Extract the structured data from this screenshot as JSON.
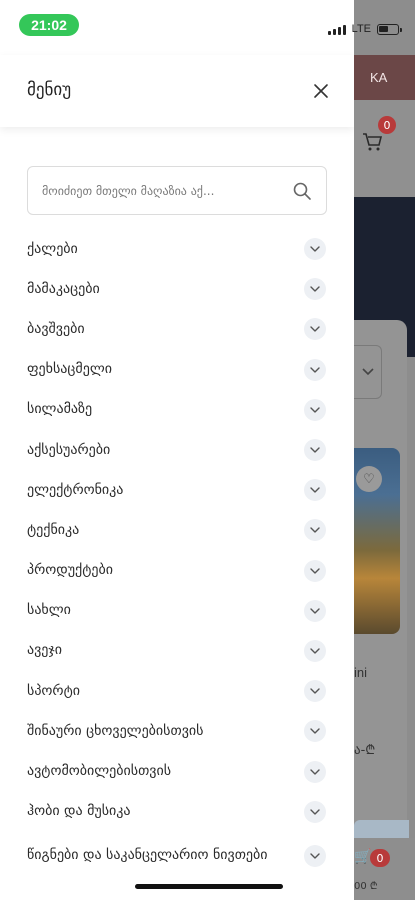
{
  "status_bar": {
    "time": "21:02",
    "network": "LTE",
    "battery_level": 0.5
  },
  "drawer": {
    "title": "მენიუ",
    "search": {
      "placeholder": "მოიძიეთ მთელი მაღაზია აქ..."
    },
    "items": [
      {
        "label": "ქალები"
      },
      {
        "label": "მამაკაცები"
      },
      {
        "label": "ბავშვები"
      },
      {
        "label": "ფეხსაცმელი"
      },
      {
        "label": "სილამაზე"
      },
      {
        "label": "აქსესუარები"
      },
      {
        "label": "ელექტრონიკა"
      },
      {
        "label": "ტექნიკა"
      },
      {
        "label": "პროდუქტები"
      },
      {
        "label": "სახლი"
      },
      {
        "label": "ავეჯი"
      },
      {
        "label": "სპორტი"
      },
      {
        "label": "შინაური ცხოველებისთვის"
      },
      {
        "label": "ავტომობილებისთვის"
      },
      {
        "label": "ჰობი და მუსიკა"
      },
      {
        "label": "წიგნები და საკანცელარიო ნივთები"
      }
    ]
  },
  "background": {
    "language": "KA",
    "cart_count": "0",
    "text_partial_1": "ini",
    "text_partial_2": "ა-₾",
    "cart_count_2": "0",
    "price_partial": "00 ₾"
  },
  "colors": {
    "time_pill": "#34c759",
    "badge": "#b83a3a",
    "chevron_bg": "#edf0f4"
  }
}
